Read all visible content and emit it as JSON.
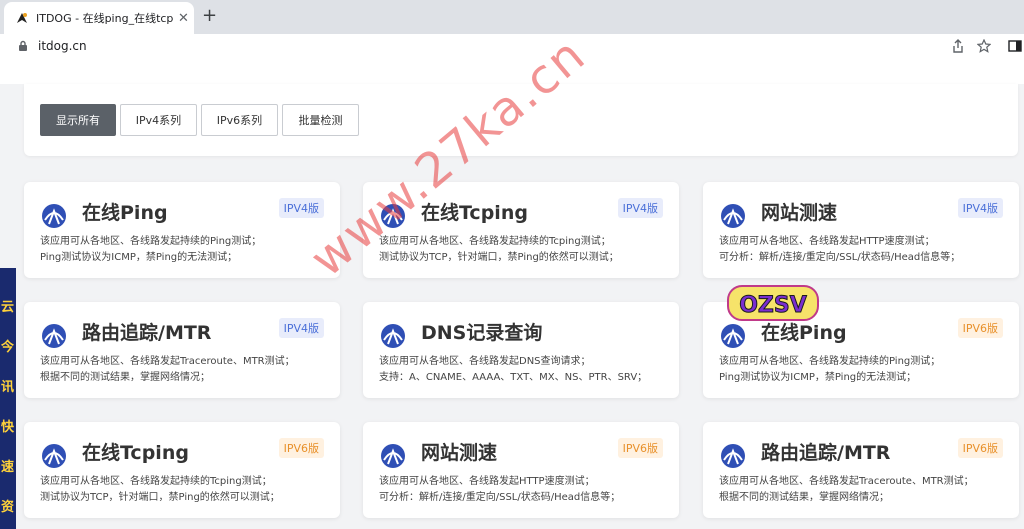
{
  "browser": {
    "tab_title": "ITDOG - 在线ping_在线tcping_",
    "tab_close": "✕",
    "new_tab": "+",
    "url": "itdog.cn"
  },
  "filters": [
    "显示所有",
    "IPv4系列",
    "IPv6系列",
    "批量检测"
  ],
  "active_filter": "显示所有",
  "cards": [
    {
      "title": "在线Ping",
      "badge": "IPV4版",
      "desc": [
        "该应用可从各地区、各线路发起持续的Ping测试；",
        "Ping测试协议为ICMP，禁Ping的无法测试；"
      ]
    },
    {
      "title": "在线Tcping",
      "badge": "IPV4版",
      "desc": [
        "该应用可从各地区、各线路发起持续的Tcping测试；",
        "测试协议为TCP，针对端口，禁Ping的依然可以测试；"
      ]
    },
    {
      "title": "网站测速",
      "badge": "IPV4版",
      "desc": [
        "该应用可从各地区、各线路发起HTTP速度测试；",
        "可分析：解析/连接/重定向/SSL/状态码/Head信息等；"
      ]
    },
    {
      "title": "路由追踪/MTR",
      "badge": "IPV4版",
      "desc": [
        "该应用可从各地区、各线路发起Traceroute、MTR测试；",
        "根据不同的测试结果，掌握网络情况；"
      ]
    },
    {
      "title": "DNS记录查询",
      "badge": "",
      "desc": [
        "该应用可从各地区、各线路发起DNS查询请求；",
        "支持：A、CNAME、AAAA、TXT、MX、NS、PTR、SRV；"
      ]
    },
    {
      "title": "在线Ping",
      "badge": "IPV6版",
      "desc": [
        "该应用可从各地区、各线路发起持续的Ping测试；",
        "Ping测试协议为ICMP，禁Ping的无法测试；"
      ]
    },
    {
      "title": "在线Tcping",
      "badge": "IPV6版",
      "desc": [
        "该应用可从各地区、各线路发起持续的Tcping测试；",
        "测试协议为TCP，针对端口，禁Ping的依然可以测试；"
      ]
    },
    {
      "title": "网站测速",
      "badge": "IPV6版",
      "desc": [
        "该应用可从各地区、各线路发起HTTP速度测试；",
        "可分析：解析/连接/重定向/SSL/状态码/Head信息等；"
      ]
    },
    {
      "title": "路由追踪/MTR",
      "badge": "IPV6版",
      "desc": [
        "该应用可从各地区、各线路发起Traceroute、MTR测试；",
        "根据不同的测试结果，掌握网络情况；"
      ]
    }
  ],
  "watermark": "www.27ka.cn",
  "overlay_logo": "OZSV",
  "side_ad_text": [
    "云",
    "今",
    "讯",
    "快",
    "速",
    "资"
  ],
  "colors": {
    "ipv4_badge": "#4a6fd8",
    "ipv6_badge": "#e8902a",
    "logo_blue": "#2f4fb5",
    "active_filter": "#5b6168"
  }
}
